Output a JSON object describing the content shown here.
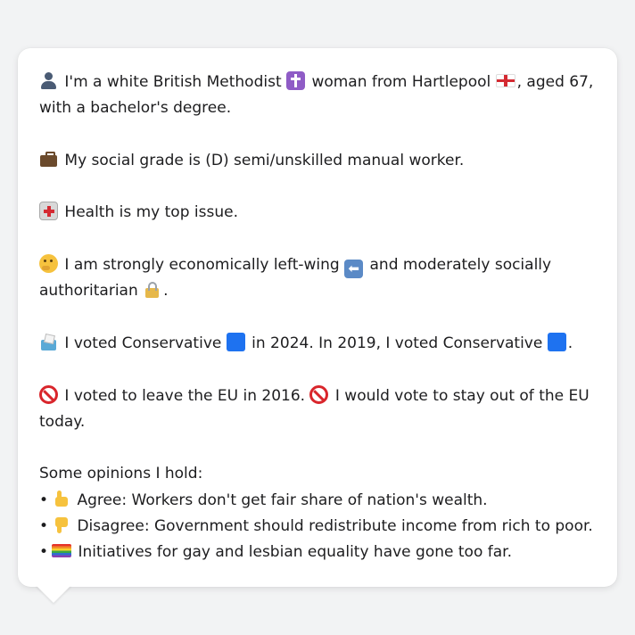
{
  "profile": {
    "intro": {
      "line1_a": "I'm a white British Methodist",
      "line1_b": "woman from Hartlepool",
      "line1_c": ", aged 67,",
      "line2": "with a bachelor's degree."
    },
    "social_grade": "My social grade is (D) semi/unskilled manual worker.",
    "top_issue": "Health is my top issue.",
    "ideology": {
      "part_a": "I am strongly economically left-wing",
      "part_b": "and moderately socially",
      "part_c": "authoritarian",
      "part_d": "."
    },
    "vote": {
      "part_a": "I voted Conservative",
      "part_b": "in 2024. In 2019, I voted Conservative",
      "part_c": "."
    },
    "brexit": {
      "part_a": "I voted to leave the EU in 2016.",
      "part_b": "I would vote to stay out of the EU",
      "part_c": "today."
    },
    "opinions": {
      "heading": "Some opinions I hold:",
      "bullet": "•",
      "items": [
        {
          "text": "Agree: Workers don't get fair share of nation's wealth.",
          "icon": "thumbs-up-icon"
        },
        {
          "text": "Disagree: Government should redistribute income from rich to poor.",
          "icon": "thumbs-down-icon"
        },
        {
          "text": "Initiatives for gay and lesbian equality have gone too far.",
          "icon": "rainbow-flag-icon"
        }
      ]
    }
  },
  "icons": {
    "person": "person-silhouette-icon",
    "religion": "latin-cross-icon",
    "place": "england-flag-icon",
    "job": "briefcase-icon",
    "health": "hospital-icon",
    "thinking": "thinking-face-icon",
    "left": "left-arrow-icon",
    "auth": "padlock-icon",
    "ballot": "ballot-box-icon",
    "party": "blue-square-icon",
    "brexit": "no-entry-icon"
  },
  "colors": {
    "background": "#f2f3f4",
    "card": "#ffffff",
    "text": "#1d1d1f",
    "conservative_blue": "#1e72f0",
    "no_entry_red": "#d9262c"
  },
  "symbols": {
    "left_arrow": "⬅"
  }
}
